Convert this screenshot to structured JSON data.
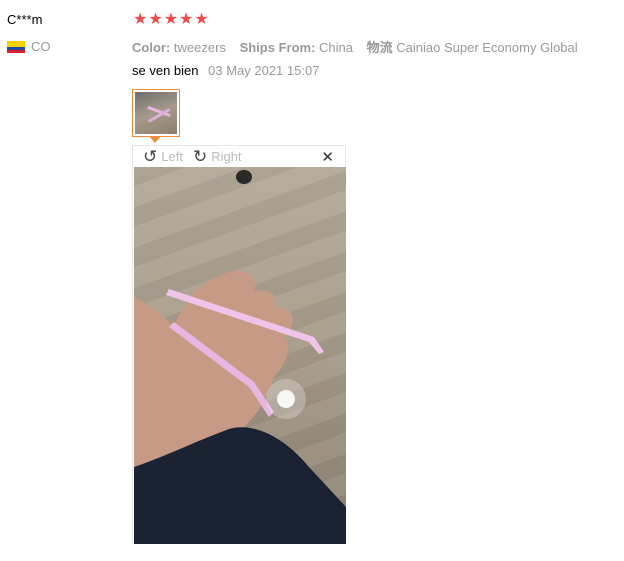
{
  "user": {
    "name": "C***m",
    "country_code": "CO"
  },
  "rating": {
    "stars": 5,
    "max": 5,
    "color": "#ef4b4b"
  },
  "meta": {
    "color_label": "Color:",
    "color_value": "tweezers",
    "ships_label": "Ships From:",
    "ships_value": "China",
    "logistics_label": "物流",
    "logistics_value": "Cainiao Super Economy Global"
  },
  "review": {
    "text": "se ven bien",
    "date": "03 May 2021 15:07"
  },
  "viewer": {
    "rotate_left_icon": "rotate-left-icon",
    "rotate_left_label": "Left",
    "rotate_right_icon": "rotate-right-icon",
    "rotate_right_label": "Right",
    "close_icon": "close-icon",
    "photo_subject": "pink tweezers in hand"
  },
  "colors": {
    "thumb_border": "#f08c3a",
    "muted": "#999999"
  }
}
